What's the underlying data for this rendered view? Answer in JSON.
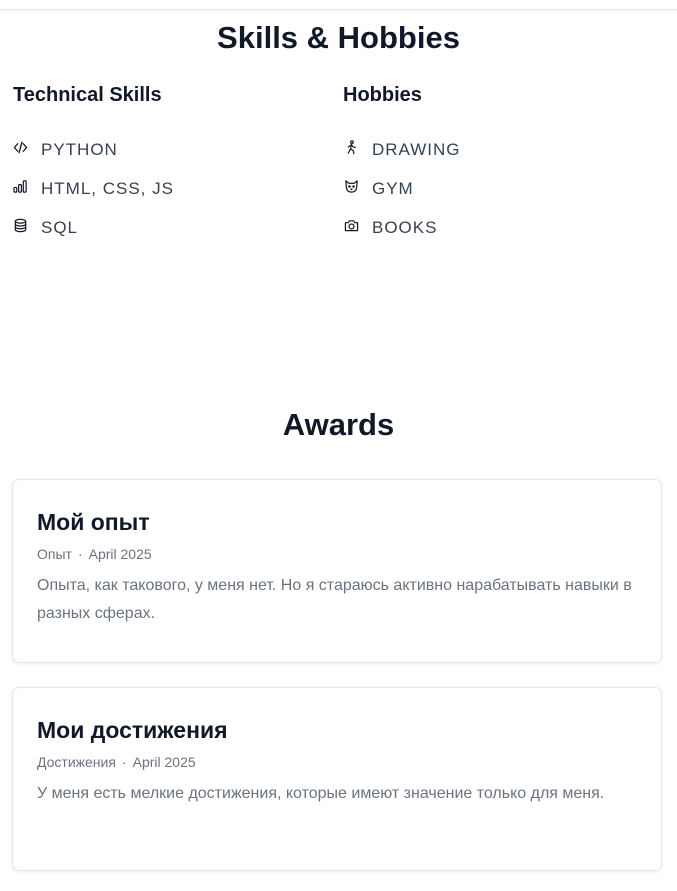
{
  "skills_section": {
    "title": "Skills & Hobbies",
    "technical": {
      "title": "Technical Skills",
      "items": [
        {
          "label": "PYTHON",
          "icon": "code-icon"
        },
        {
          "label": "HTML, CSS, JS",
          "icon": "bar-chart-icon"
        },
        {
          "label": "SQL",
          "icon": "database-icon"
        }
      ]
    },
    "hobbies": {
      "title": "Hobbies",
      "items": [
        {
          "label": "DRAWING",
          "icon": "walking-person-icon"
        },
        {
          "label": "GYM",
          "icon": "cat-face-icon"
        },
        {
          "label": "BOOKS",
          "icon": "camera-icon"
        }
      ]
    }
  },
  "awards_section": {
    "title": "Awards",
    "cards": [
      {
        "title": "Мой опыт",
        "category": "Опыт",
        "separator": "·",
        "date": "April 2025",
        "description": "Опыта, как такового, у меня нет. Но я стараюсь активно нарабатывать навыки в разных сферах."
      },
      {
        "title": "Мои достижения",
        "category": "Достижения",
        "separator": "·",
        "date": "April 2025",
        "description": "У меня есть мелкие достижения, которые имеют значение только для меня."
      }
    ]
  }
}
